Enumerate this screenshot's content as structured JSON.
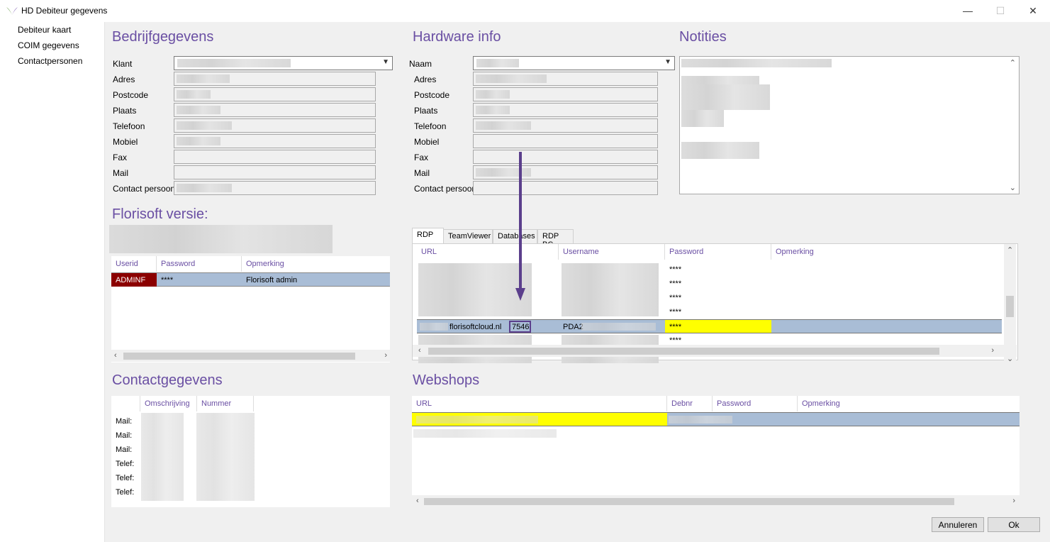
{
  "window": {
    "title": "HD Debiteur gegevens",
    "minimize": "—",
    "maximize": "☐",
    "close": "✕"
  },
  "nav": {
    "items": [
      "Debiteur kaart",
      "COIM gegevens",
      "Contactpersonen"
    ]
  },
  "bedrijf": {
    "title": "Bedrijfgegevens",
    "labels": [
      "Klant",
      "Adres",
      "Postcode",
      "Plaats",
      "Telefoon",
      "Mobiel",
      "Fax",
      "Mail",
      "Contact persoon"
    ]
  },
  "hardware": {
    "title": "Hardware info",
    "labels": [
      "Naam",
      "Adres",
      "Postcode",
      "Plaats",
      "Telefoon",
      "Mobiel",
      "Fax",
      "Mail",
      "Contact persoon"
    ]
  },
  "notities": {
    "title": "Notities"
  },
  "florisoft": {
    "title": "Florisoft versie:",
    "columns": [
      "Userid",
      "Password",
      "Opmerking"
    ],
    "row": {
      "userid": "ADMINF",
      "password": "****",
      "opmerking": "Florisoft admin"
    }
  },
  "remote": {
    "tabs": [
      "RDP",
      "TeamViewer",
      "Databases",
      "RDP BC"
    ],
    "columns": [
      "URL",
      "Username",
      "Password",
      "Opmerking"
    ],
    "password_mask": "****",
    "selected_url": "florisoftcloud.nl",
    "selected_port": "7546",
    "selected_username": "PDA2"
  },
  "contact": {
    "title": "Contactgegevens",
    "columns": [
      "Omschrijving",
      "Nummer"
    ],
    "rows": [
      "Mail:",
      "Mail:",
      "Mail:",
      "Telef:",
      "Telef:",
      "Telef:"
    ]
  },
  "webshops": {
    "title": "Webshops",
    "columns": [
      "URL",
      "Debnr",
      "Password",
      "Opmerking"
    ]
  },
  "buttons": {
    "cancel": "Annuleren",
    "ok": "Ok"
  },
  "colors": {
    "accent": "#6a4fa3",
    "selection": "#a9bdd6",
    "highlight": "#ffff00",
    "userid_bg": "#8b0000"
  }
}
